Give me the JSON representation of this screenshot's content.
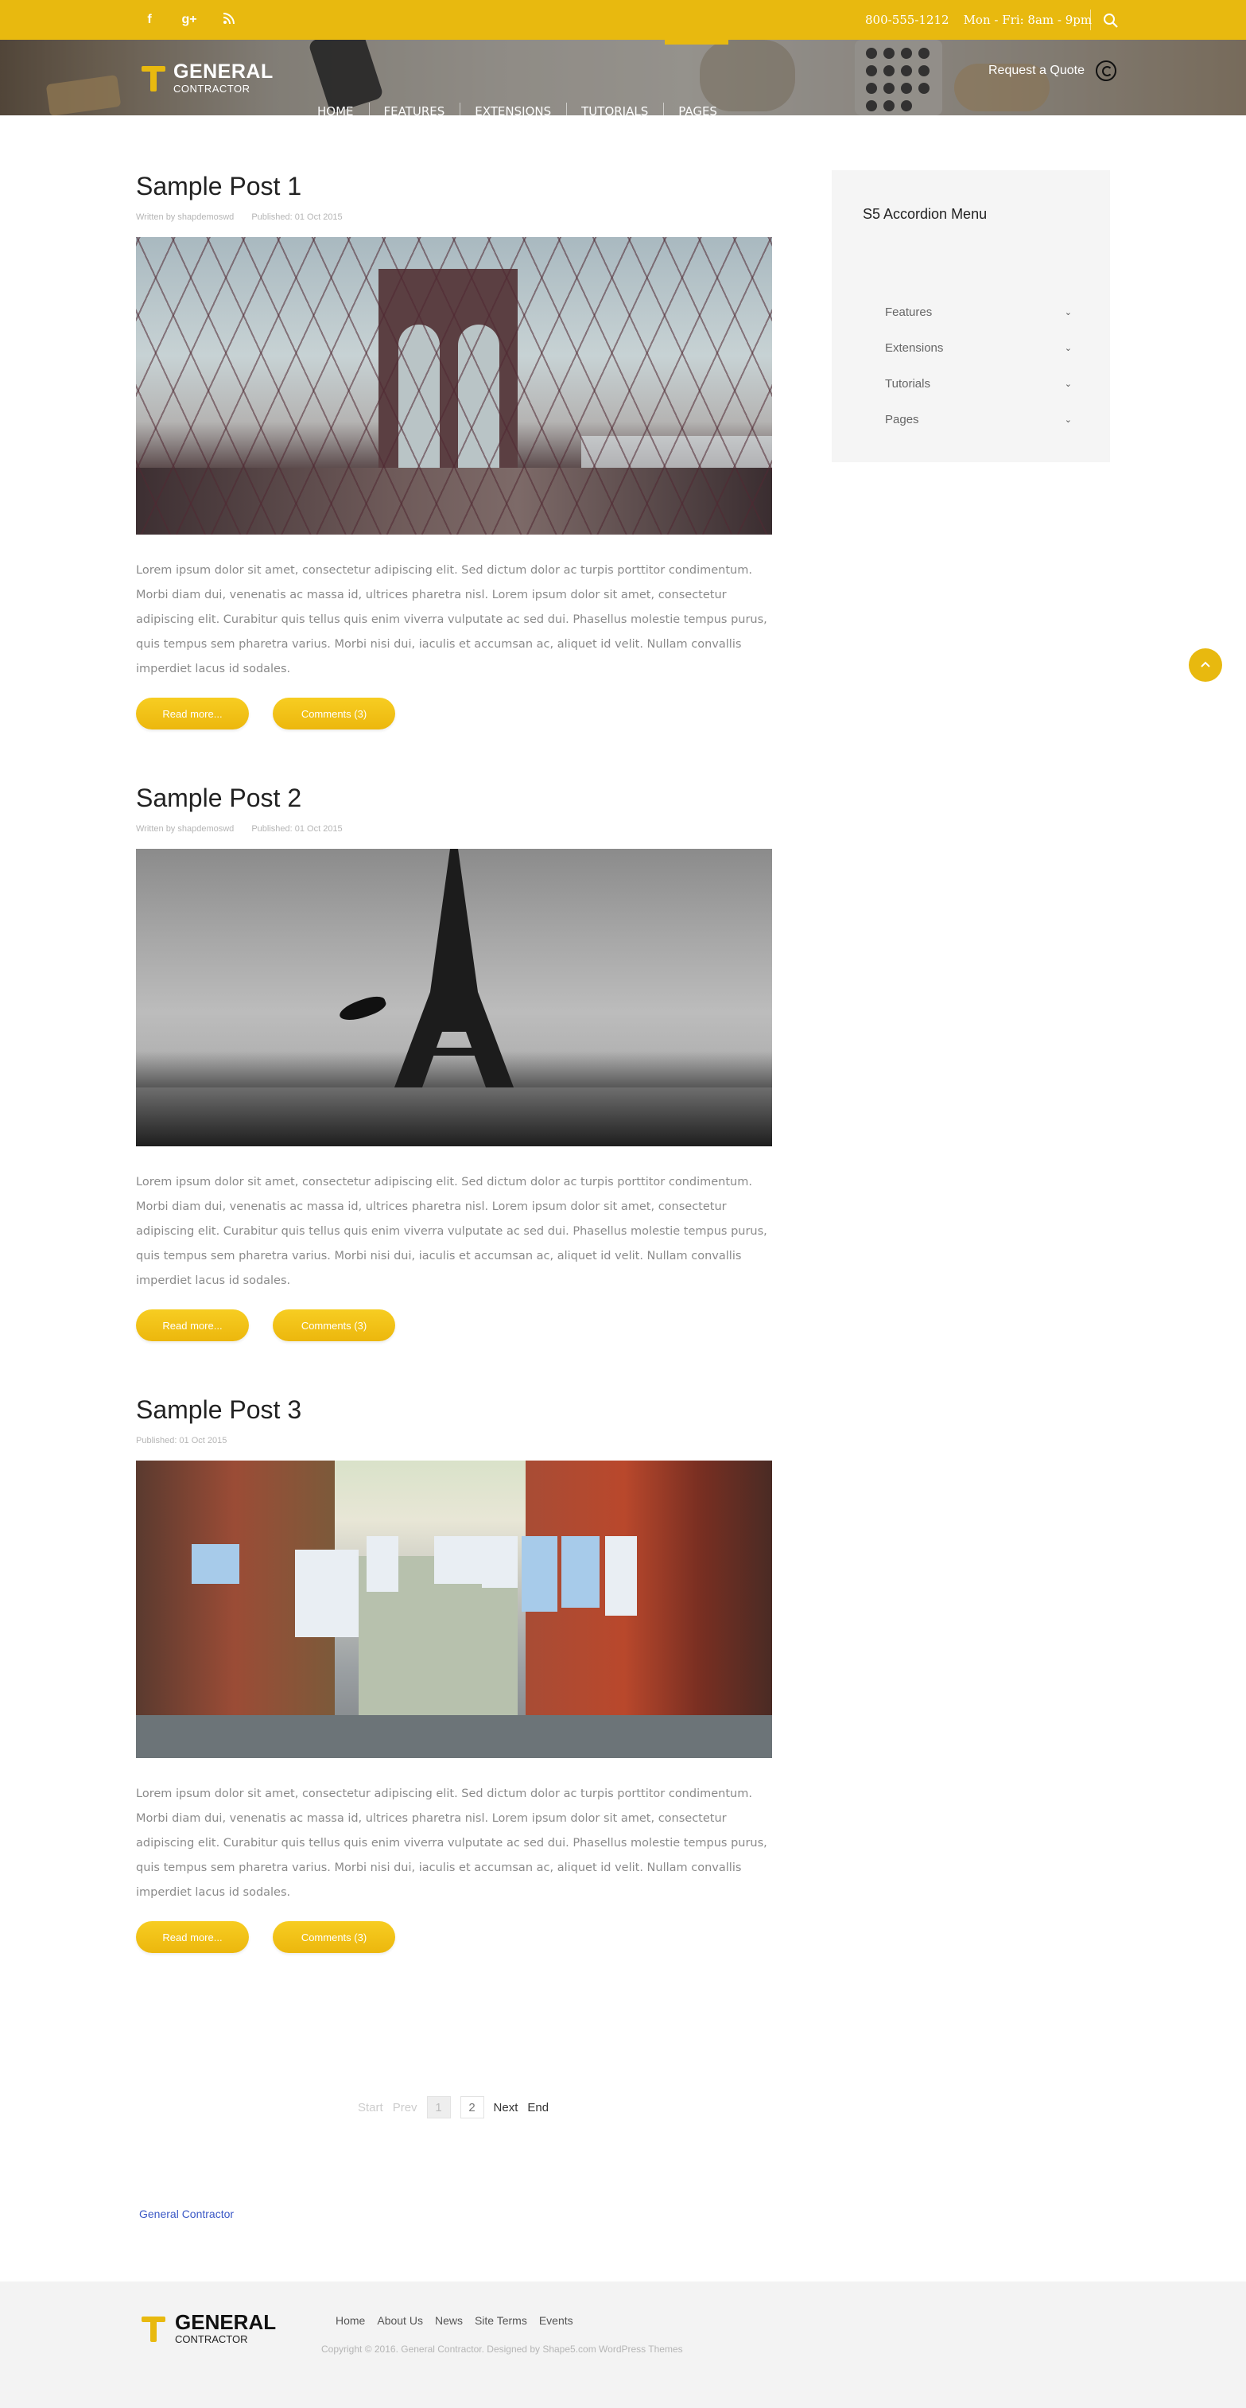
{
  "topbar": {
    "phone": "800-555-1212",
    "hours": "Mon - Fri: 8am - 9pm",
    "social": [
      {
        "icon": "facebook-icon",
        "glyph": "f"
      },
      {
        "icon": "google-plus-icon",
        "glyph": "g+"
      },
      {
        "icon": "rss-icon",
        "glyph": "⧉"
      }
    ]
  },
  "header": {
    "logo_name": "GENERAL",
    "logo_sub": "CONTRACTOR",
    "nav": [
      "HOME",
      "FEATURES",
      "EXTENSIONS",
      "TUTORIALS",
      "PAGES"
    ],
    "quote_label": "Request a Quote"
  },
  "posts": [
    {
      "title": "Sample Post 1",
      "author": "Written by shapdemoswd",
      "published": "Published: 01 Oct 2015",
      "text": "Lorem ipsum dolor sit amet, consectetur adipiscing elit. Sed dictum dolor ac turpis porttitor condimentum. Morbi diam dui, venenatis ac massa id, ultrices pharetra nisl. Lorem ipsum dolor sit amet, consectetur adipiscing elit. Curabitur quis tellus quis enim viverra vulputate ac sed dui. Phasellus molestie tempus purus, quis tempus sem pharetra varius. Morbi nisi dui, iaculis et accumsan ac, aliquet id velit. Nullam convallis imperdiet lacus id sodales.",
      "read_more": "Read more...",
      "comments": "Comments (3)"
    },
    {
      "title": "Sample Post 2",
      "author": "Written by shapdemoswd",
      "published": "Published: 01 Oct 2015",
      "text": "Lorem ipsum dolor sit amet, consectetur adipiscing elit. Sed dictum dolor ac turpis porttitor condimentum. Morbi diam dui, venenatis ac massa id, ultrices pharetra nisl. Lorem ipsum dolor sit amet, consectetur adipiscing elit. Curabitur quis tellus quis enim viverra vulputate ac sed dui. Phasellus molestie tempus purus, quis tempus sem pharetra varius. Morbi nisi dui, iaculis et accumsan ac, aliquet id velit. Nullam convallis imperdiet lacus id sodales.",
      "read_more": "Read more...",
      "comments": "Comments (3)"
    },
    {
      "title": "Sample Post 3",
      "published": "Published: 01 Oct 2015",
      "text": "Lorem ipsum dolor sit amet, consectetur adipiscing elit. Sed dictum dolor ac turpis porttitor condimentum. Morbi diam dui, venenatis ac massa id, ultrices pharetra nisl. Lorem ipsum dolor sit amet, consectetur adipiscing elit. Curabitur quis tellus quis enim viverra vulputate ac sed dui. Phasellus molestie tempus purus, quis tempus sem pharetra varius. Morbi nisi dui, iaculis et accumsan ac, aliquet id velit. Nullam convallis imperdiet lacus id sodales.",
      "read_more": "Read more...",
      "comments": "Comments (3)"
    }
  ],
  "sidebar": {
    "title": "S5 Accordion Menu",
    "items": [
      "Features",
      "Extensions",
      "Tutorials",
      "Pages"
    ]
  },
  "pagination": {
    "start": "Start",
    "prev": "Prev",
    "pages": [
      "1",
      "2"
    ],
    "current": "1",
    "next": "Next",
    "end": "End"
  },
  "bottom_link": "General Contractor",
  "footer": {
    "logo_name": "GENERAL",
    "logo_sub": "CONTRACTOR",
    "links": [
      "Home",
      "About Us",
      "News",
      "Site Terms",
      "Events"
    ],
    "copyright": "Copyright © 2016. General Contractor. Designed by Shape5.com WordPress Themes"
  },
  "colors": {
    "accent": "#e8b90f",
    "link": "#3b59c6"
  }
}
